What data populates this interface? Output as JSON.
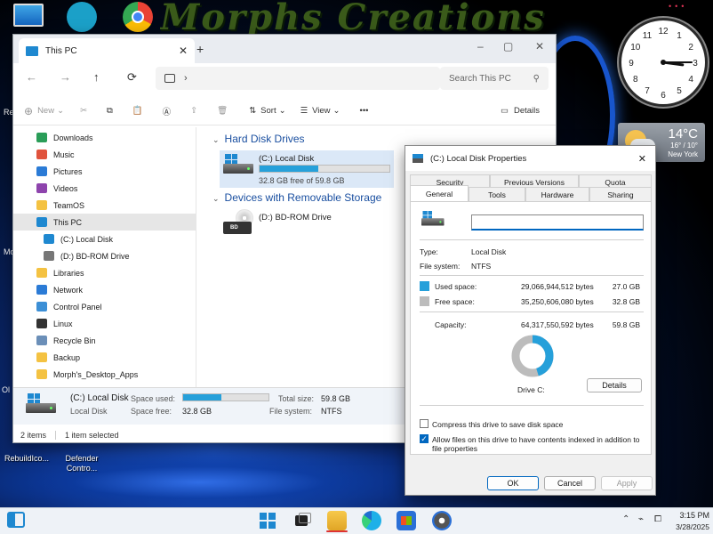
{
  "desktop": {
    "banner": "Morphs Creations",
    "icons": [
      {
        "label": "RebuildIco..."
      },
      {
        "label": "Defender Contro..."
      }
    ],
    "edge_labels": [
      "Re",
      "Mo",
      "Ol"
    ]
  },
  "explorer": {
    "tab_title": "This PC",
    "new_tab": "+",
    "window_controls": [
      "–",
      "▢",
      "✕"
    ],
    "nav": {
      "back": "←",
      "forward": "→",
      "up": "↑",
      "refresh": "⟳"
    },
    "address_chevron": "›",
    "search_placeholder": "Search This PC",
    "toolbar": {
      "new": "New",
      "sort": "Sort",
      "view": "View",
      "more": "•••",
      "details": "Details"
    },
    "sidebar": [
      {
        "label": "Downloads",
        "icon": "download-icon",
        "color": "#2a9d58",
        "selected": false,
        "sub": false
      },
      {
        "label": "Music",
        "icon": "music-icon",
        "color": "#e0533d",
        "selected": false,
        "sub": false
      },
      {
        "label": "Pictures",
        "icon": "pictures-icon",
        "color": "#2b7bd6",
        "selected": false,
        "sub": false
      },
      {
        "label": "Videos",
        "icon": "videos-icon",
        "color": "#8e44ad",
        "selected": false,
        "sub": false
      },
      {
        "label": "TeamOS",
        "icon": "folder-icon",
        "color": "#f4c242",
        "selected": false,
        "sub": false
      },
      {
        "label": "This PC",
        "icon": "pc-icon",
        "color": "#1e88d0",
        "selected": true,
        "sub": false
      },
      {
        "label": "(C:) Local Disk",
        "icon": "drive-icon",
        "color": "#1e88d0",
        "selected": false,
        "sub": true
      },
      {
        "label": "(D:) BD-ROM Drive",
        "icon": "disc-icon",
        "color": "#777777",
        "selected": false,
        "sub": true
      },
      {
        "label": "Libraries",
        "icon": "folder-icon",
        "color": "#f4c242",
        "selected": false,
        "sub": false
      },
      {
        "label": "Network",
        "icon": "network-icon",
        "color": "#2b7bd6",
        "selected": false,
        "sub": false
      },
      {
        "label": "Control Panel",
        "icon": "control-panel-icon",
        "color": "#3c8fd6",
        "selected": false,
        "sub": false
      },
      {
        "label": "Linux",
        "icon": "linux-icon",
        "color": "#333333",
        "selected": false,
        "sub": false
      },
      {
        "label": "Recycle Bin",
        "icon": "recycle-bin-icon",
        "color": "#6b8fb8",
        "selected": false,
        "sub": false
      },
      {
        "label": "Backup",
        "icon": "folder-icon",
        "color": "#f4c242",
        "selected": false,
        "sub": false
      },
      {
        "label": "Morph's_Desktop_Apps",
        "icon": "folder-icon",
        "color": "#f4c242",
        "selected": false,
        "sub": false
      }
    ],
    "content": {
      "hdd_header": "Hard Disk Drives",
      "c_name": "(C:) Local Disk",
      "c_free": "32.8 GB free of 59.8 GB",
      "c_used_fraction": 0.452,
      "removable_header": "Devices with Removable Storage",
      "d_name": "(D:) BD-ROM Drive",
      "bd_badge": "BD"
    },
    "details_pane": {
      "name": "(C:) Local Disk",
      "type": "Local Disk",
      "space_used_label": "Space used:",
      "space_free_label": "Space free:",
      "space_free": "32.8 GB",
      "total_size_label": "Total size:",
      "total_size": "59.8 GB",
      "file_system_label": "File system:",
      "file_system": "NTFS"
    },
    "status": {
      "items": "2 items",
      "selected": "1 item selected"
    }
  },
  "properties": {
    "title": "(C:) Local Disk Properties",
    "close": "✕",
    "tabs_row1": [
      "Security",
      "Previous Versions",
      "Quota"
    ],
    "tabs_row2": [
      "General",
      "Tools",
      "Hardware",
      "Sharing"
    ],
    "active_tab": "General",
    "label_value": "",
    "type_label": "Type:",
    "type_value": "Local Disk",
    "fs_label": "File system:",
    "fs_value": "NTFS",
    "used_label": "Used space:",
    "used_bytes": "29,066,944,512 bytes",
    "used_gb": "27.0 GB",
    "free_label": "Free space:",
    "free_bytes": "35,250,606,080 bytes",
    "free_gb": "32.8 GB",
    "capacity_label": "Capacity:",
    "capacity_bytes": "64,317,550,592 bytes",
    "capacity_gb": "59.8 GB",
    "used_fraction": 0.452,
    "used_color": "#26a0da",
    "free_color": "#bcbcbc",
    "drive_label": "Drive C:",
    "details_button": "Details",
    "compress_label": "Compress this drive to save disk space",
    "compress_checked": false,
    "index_label": "Allow files on this drive to have contents indexed in addition to file properties",
    "index_checked": true,
    "ok": "OK",
    "cancel": "Cancel",
    "apply": "Apply"
  },
  "clock_widget": {
    "numbers": [
      "12",
      "1",
      "2",
      "3",
      "4",
      "5",
      "6",
      "7",
      "8",
      "9",
      "10",
      "11"
    ],
    "time": "3:15"
  },
  "weather": {
    "temp": "14°C",
    "range": "16° / 10°",
    "city": "New York"
  },
  "taskbar": {
    "time": "3:15 PM",
    "date": "3/28/2025"
  }
}
